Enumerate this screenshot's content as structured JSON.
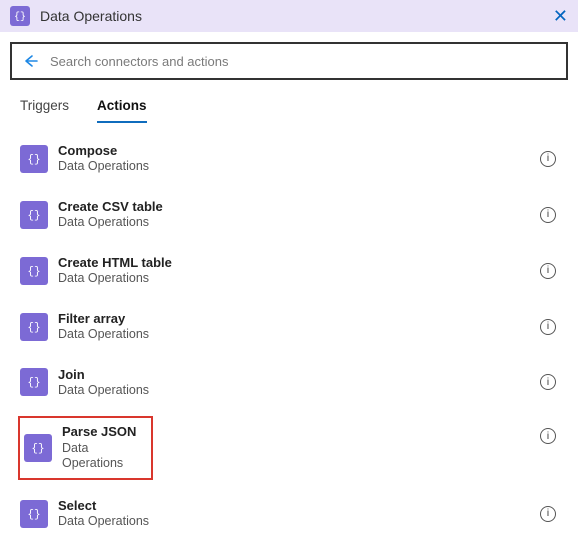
{
  "header": {
    "title": "Data Operations"
  },
  "search": {
    "placeholder": "Search connectors and actions"
  },
  "tabs": {
    "triggers": "Triggers",
    "actions": "Actions"
  },
  "connector_sub": "Data Operations",
  "actions": {
    "compose": "Compose",
    "csv": "Create CSV table",
    "html": "Create HTML table",
    "filter": "Filter array",
    "join": "Join",
    "parsejson": "Parse JSON",
    "select": "Select"
  }
}
